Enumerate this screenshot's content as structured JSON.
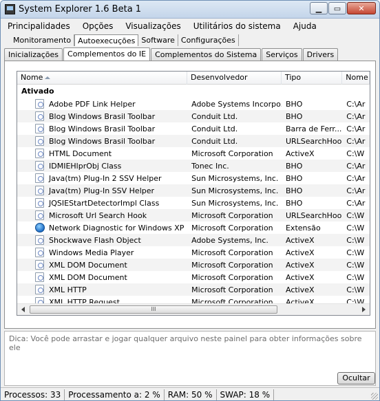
{
  "window": {
    "title": "System Explorer 1.6 Beta 1"
  },
  "caption": {
    "minimize": "▁",
    "maximize": "▭",
    "close": "✕"
  },
  "menu": [
    "Principalidades",
    "Opções",
    "Visualizações",
    "Utilitários do sistema",
    "Ajuda"
  ],
  "main_tabs": [
    "Monitoramento",
    "Autoexecuções",
    "Software",
    "Configurações"
  ],
  "main_tab_active": 1,
  "sub_tabs": [
    "Inicializações",
    "Complementos do IE",
    "Complementos do Sistema",
    "Serviços",
    "Drivers"
  ],
  "sub_tab_active": 1,
  "list": {
    "columns": [
      "Nome",
      "Desenvolvedor",
      "Tipo",
      "Nome"
    ],
    "group": "Ativado",
    "rows": [
      {
        "name": "Adobe PDF Link Helper",
        "dev": "Adobe Systems Incorpo...",
        "type": "BHO",
        "path": "C:\\Ar",
        "icon": "file-icon"
      },
      {
        "name": "Blog Windows Brasil Toolbar",
        "dev": "Conduit Ltd.",
        "type": "BHO",
        "path": "C:\\Ar",
        "icon": "file-icon"
      },
      {
        "name": "Blog Windows Brasil Toolbar",
        "dev": "Conduit Ltd.",
        "type": "Barra de Ferr...",
        "path": "C:\\Ar",
        "icon": "file-icon"
      },
      {
        "name": "Blog Windows Brasil Toolbar",
        "dev": "Conduit Ltd.",
        "type": "URLSearchHook",
        "path": "C:\\Ar",
        "icon": "file-icon"
      },
      {
        "name": "HTML Document",
        "dev": "Microsoft Corporation",
        "type": "ActiveX",
        "path": "C:\\W",
        "icon": "file-icon"
      },
      {
        "name": "IDMIEHlprObj Class",
        "dev": "Tonec Inc.",
        "type": "BHO",
        "path": "C:\\Ar",
        "icon": "file-icon"
      },
      {
        "name": "Java(tm) Plug-In 2 SSV Helper",
        "dev": "Sun Microsystems, Inc.",
        "type": "BHO",
        "path": "C:\\Ar",
        "icon": "file-icon"
      },
      {
        "name": "Java(tm) Plug-In SSV Helper",
        "dev": "Sun Microsystems, Inc.",
        "type": "BHO",
        "path": "C:\\Ar",
        "icon": "file-icon"
      },
      {
        "name": "JQSIEStartDetectorImpl Class",
        "dev": "Sun Microsystems, Inc.",
        "type": "BHO",
        "path": "C:\\Ar",
        "icon": "file-icon"
      },
      {
        "name": "Microsoft Url Search Hook",
        "dev": "Microsoft Corporation",
        "type": "URLSearchHook",
        "path": "C:\\W",
        "icon": "file-icon"
      },
      {
        "name": "Network Diagnostic for Windows XP",
        "dev": "Microsoft Corporation",
        "type": "Extensão",
        "path": "C:\\W",
        "icon": "globe-icon"
      },
      {
        "name": "Shockwave Flash Object",
        "dev": "Adobe Systems, Inc.",
        "type": "ActiveX",
        "path": "C:\\W",
        "icon": "file-icon"
      },
      {
        "name": "Windows Media Player",
        "dev": "Microsoft Corporation",
        "type": "ActiveX",
        "path": "C:\\W",
        "icon": "file-icon"
      },
      {
        "name": "XML DOM Document",
        "dev": "Microsoft Corporation",
        "type": "ActiveX",
        "path": "C:\\W",
        "icon": "file-icon"
      },
      {
        "name": "XML DOM Document",
        "dev": "Microsoft Corporation",
        "type": "ActiveX",
        "path": "C:\\W",
        "icon": "file-icon"
      },
      {
        "name": "XML HTTP",
        "dev": "Microsoft Corporation",
        "type": "ActiveX",
        "path": "C:\\W",
        "icon": "file-icon"
      },
      {
        "name": "XML HTTP Request",
        "dev": "Microsoft Corporation",
        "type": "ActiveX",
        "path": "C:\\W",
        "icon": "file-icon"
      }
    ],
    "scroll_thumb_glyph": "III"
  },
  "hint": "Dica: Você pode arrastar e jogar qualquer arquivo neste painel para obter informações sobre ele",
  "hide_button": "Ocultar",
  "status": {
    "processes": "Processos: 33",
    "processing": "Processamento a: 2 %",
    "ram": "RAM: 50 %",
    "swap": "SWAP: 18 %"
  }
}
